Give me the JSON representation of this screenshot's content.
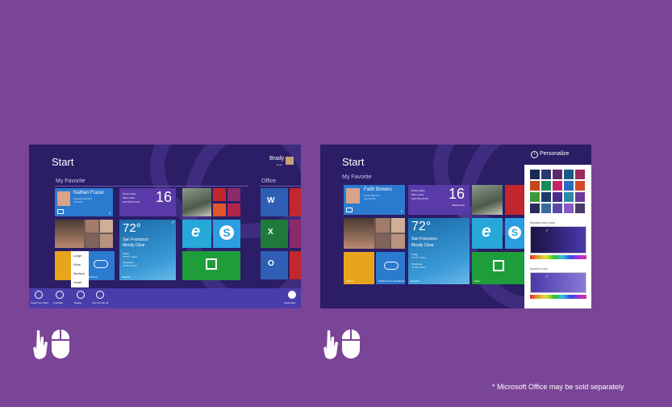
{
  "left_screen": {
    "start_title": "Start",
    "user_name": "Brady",
    "user_sub": "Jones",
    "group1": "My Favorite",
    "group2": "Office",
    "people_tile": {
      "name": "Nathan Frazer",
      "line1": "Property Meeting",
      "line2": "I'll thnks!",
      "count": "3"
    },
    "calendar_tile": {
      "line1": "Dinner Party",
      "line2": "Main Lobby",
      "line3": "6:30 PM-10 PM",
      "date": "16"
    },
    "weather_tile": {
      "temp": "72°",
      "city": "San Francisco",
      "cond": "Mostly Clear",
      "today": "Today",
      "today_range": "75°/57° Clear",
      "tomorrow": "Tomorrow",
      "tomorrow_range": "70°/54° Clear",
      "label": "Weather"
    },
    "skydrive_label": "SkyDrive",
    "context_menu": [
      "Large",
      "Wide",
      "Medium",
      "Small"
    ],
    "app_bar": [
      {
        "label": "Unpin from Start",
        "icon": "unpin-icon"
      },
      {
        "label": "Uninstall",
        "icon": "uninstall-icon"
      },
      {
        "label": "Resize",
        "icon": "resize-icon"
      },
      {
        "label": "Turn live tile off",
        "icon": "live-tile-icon"
      },
      {
        "label": "Customize",
        "icon": "customize-icon"
      }
    ]
  },
  "right_screen": {
    "start_title": "Start",
    "group1": "My Favorite",
    "people_tile": {
      "name": "Faith Bowers",
      "line1": "Lunch Meeting",
      "line2": "Hey Brady!",
      "count": "2"
    },
    "calendar_tile": {
      "line1": "Dinner Party",
      "line2": "Main Lobby",
      "line3": "6:30 PM-10 PM",
      "date": "16",
      "day": "Wednesday"
    },
    "weather_tile": {
      "temp": "72°",
      "city": "San Francisco",
      "cond": "Mostly Clear",
      "today": "Today",
      "today_range": "75°/57° Clear",
      "tomorrow": "Tomorrow",
      "tomorrow_range": "70°/54° Clear",
      "label": "Weather"
    },
    "photos_label": "Photos",
    "skydrive_label": "SkyDrive Pro (OneDrive)",
    "weather_label": "Weather",
    "store_label": "Store",
    "personalize": {
      "title": "Personalize",
      "background_label": "Background color",
      "accent_label": "Accent color"
    }
  },
  "footnote": "* Microsoft Office may be sold separately",
  "colors": {
    "page_bg": "#7b4597",
    "start_bg": "#2b1d66",
    "tile_blue": "#2a7ad0",
    "tile_green": "#1e9e3a",
    "tile_cyan": "#26a8d8",
    "tile_orange": "#e8a51c",
    "tile_purple": "#5a3aa8",
    "tile_red": "#c1272d"
  }
}
